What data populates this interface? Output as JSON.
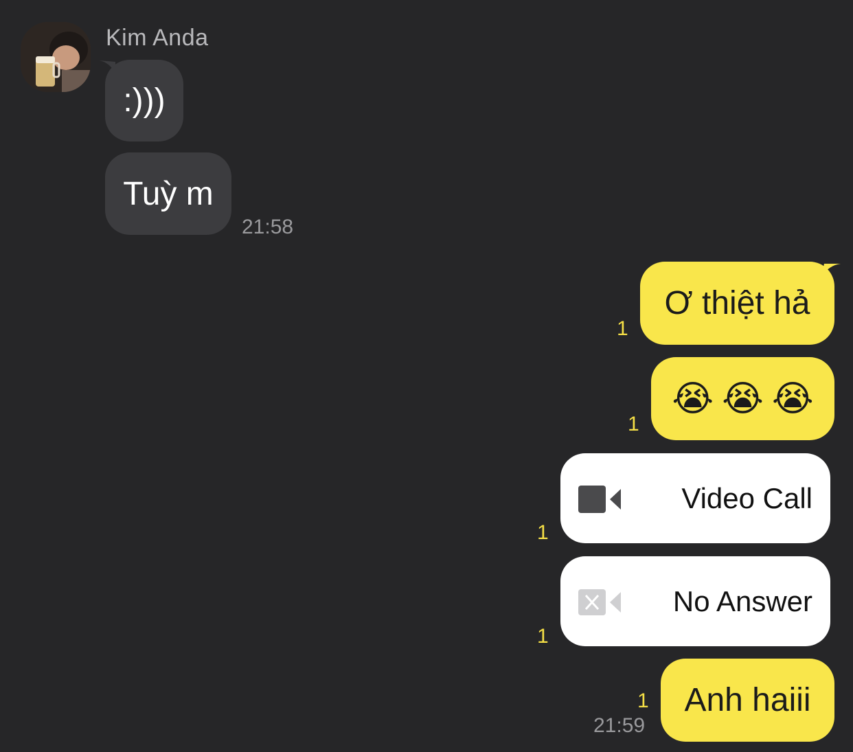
{
  "chat": {
    "sender_name": "Kim Anda",
    "incoming": [
      {
        "text": ":)))"
      },
      {
        "text": "Tuỳ m",
        "time": "21:58"
      }
    ],
    "outgoing": [
      {
        "text": "Ơ thiệt hả",
        "unread": "1"
      },
      {
        "emojis": [
          "😭",
          "😭",
          "😭"
        ],
        "unread": "1"
      },
      {
        "call_label": "Video Call",
        "icon": "video-camera-icon",
        "unread": "1"
      },
      {
        "call_label": "No Answer",
        "icon": "video-camera-missed-icon",
        "unread": "1"
      },
      {
        "text": "Anh haiii",
        "unread": "1",
        "time": "21:59"
      }
    ]
  },
  "colors": {
    "background": "#262628",
    "incoming_bubble": "#3c3c3f",
    "outgoing_bubble": "#f9e64b",
    "call_card": "#ffffff",
    "unread_count": "#f5df46",
    "timestamp": "#9a9a9d"
  }
}
